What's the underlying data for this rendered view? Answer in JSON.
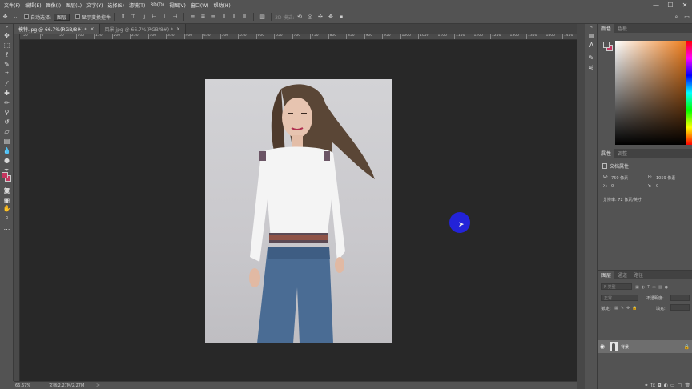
{
  "menu": [
    "文件(F)",
    "编辑(E)",
    "图像(I)",
    "图层(L)",
    "文字(Y)",
    "选择(S)",
    "滤镜(T)",
    "3D(D)",
    "视图(V)",
    "窗口(W)",
    "帮助(H)"
  ],
  "window_controls": [
    "—",
    "☐",
    "✕"
  ],
  "options_bar": {
    "auto_select_label": "自动选择:",
    "auto_select_value": "图层",
    "show_transform_label": "显示变换控件",
    "mode_3d_label": "3D 模式:"
  },
  "tabs": [
    {
      "label": "模特.jpg @ 66.7%(RGB/8#) *",
      "close": "×"
    },
    {
      "label": "风景.jpg @ 66.7%(RGB/8#) *",
      "close": "×"
    }
  ],
  "ruler_ticks": [
    "50",
    "0",
    "50",
    "100",
    "150",
    "200",
    "250",
    "300",
    "350",
    "400",
    "450",
    "500",
    "550",
    "600",
    "650",
    "700",
    "750",
    "800",
    "850",
    "900",
    "950",
    "1000",
    "1050",
    "1100",
    "1150",
    "1200",
    "1250",
    "1300",
    "1350",
    "1400",
    "1450"
  ],
  "status": {
    "zoom": "66.67%",
    "doc_info": "文档:2.27M/2.27M",
    "arrow": ">"
  },
  "color_panel": {
    "tab_color": "颜色",
    "tab_swatches": "色板",
    "foreground": "#535353",
    "background": "#c4365f"
  },
  "properties_panel": {
    "tab_props": "属性",
    "tab_adjust": "调整",
    "title": "文档属性",
    "w_label": "W:",
    "w_value": "750 像素",
    "h_label": "H:",
    "h_value": "1059 像素",
    "x_label": "X:",
    "x_value": "0",
    "y_label": "Y:",
    "y_value": "0",
    "resolution": "分辨率: 72 像素/英寸"
  },
  "layers_panel": {
    "tab_layers": "图层",
    "tab_channels": "通道",
    "tab_paths": "路径",
    "kind_filter": "P 类型",
    "blend_mode": "正常",
    "opacity_label": "不透明度:",
    "lock_label": "锁定:",
    "fill_label": "填充:",
    "layer_name": "背景"
  },
  "colors": {
    "accent_swatch": "#c4365f",
    "cursor_highlight": "#2323d8"
  }
}
